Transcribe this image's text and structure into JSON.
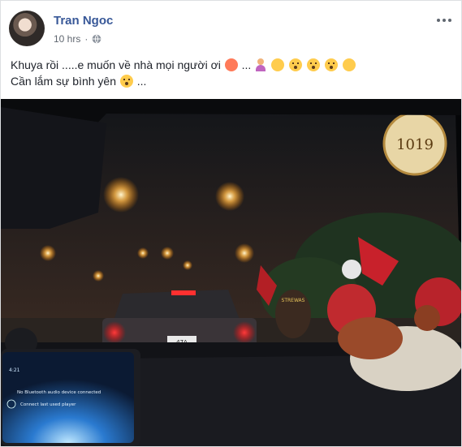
{
  "post": {
    "author": "Tran Ngoc",
    "time": "10 hrs",
    "privacy_icon": "globe-icon",
    "menu_icon": "more-options-icon",
    "line1_text": "Khuya rồi .....e muốn về nhà mọi người ơi",
    "line1_suffix": "...",
    "line2_text": "Cần lắm sự bình yên",
    "line2_suffix": "..."
  },
  "photo": {
    "store_sign": "1019",
    "plate_top": "47A",
    "plate_bottom": "12120",
    "shirt_text": "STREWAS",
    "screen_time": "4:21",
    "screen_line1": "No Bluetooth audio device connected",
    "screen_line2": "Connect last used player"
  },
  "colors": {
    "author": "#385898",
    "text": "#1d2129",
    "meta": "#606770"
  }
}
